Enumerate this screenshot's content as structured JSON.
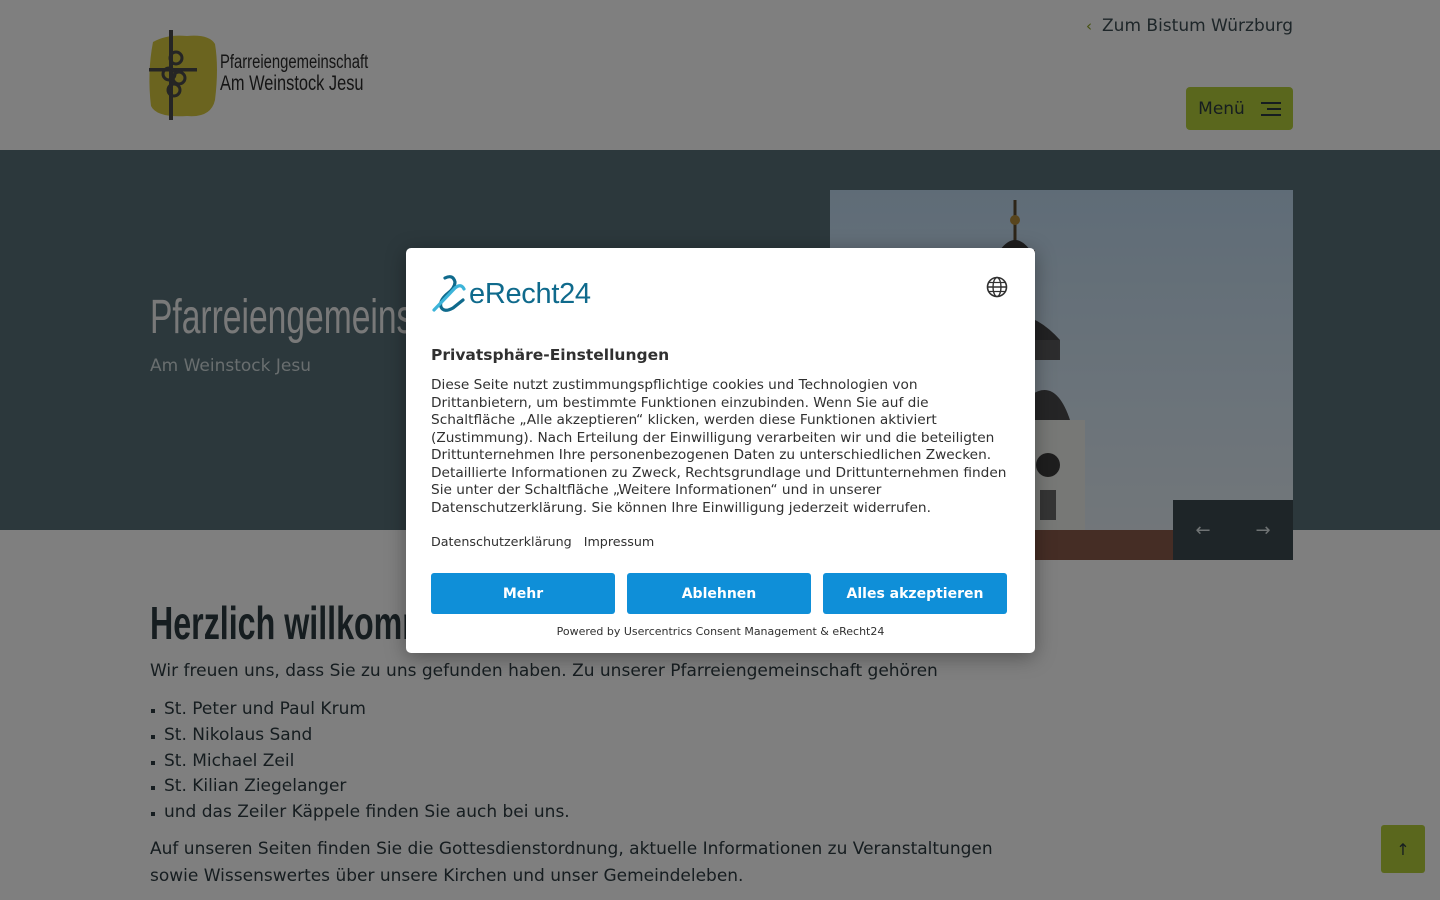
{
  "header": {
    "logo": {
      "line1": "Pfarreiengemeinschaft",
      "line2": "Am Weinstock Jesu"
    },
    "back_link": "Zum Bistum Würzburg",
    "menu_label": "Menü",
    "colors": {
      "accent": "#b4cf3a",
      "logo_yellow": "#d7c93f"
    }
  },
  "hero": {
    "title": "Pfarreiengemeinschaft",
    "subtitle": "Am Weinstock Jesu",
    "background": "#587178",
    "image": "church-tower-photo",
    "prev_icon": "arrow-left-icon",
    "next_icon": "arrow-right-icon"
  },
  "content": {
    "title": "Herzlich willkommen",
    "intro": "Wir freuen uns, dass Sie zu uns gefunden haben. Zu unserer Pfarreiengemeinschaft gehören",
    "churches": [
      "St. Peter und Paul Krum",
      "St. Nikolaus Sand",
      "St. Michael Zeil",
      "St. Kilian Ziegelanger",
      "und das Zeiler Käppele finden Sie auch bei uns."
    ],
    "outro": "Auf unseren Seiten finden Sie die Gottesdienstordnung, aktuelle Informationen zu Veranstaltungen sowie Wissenswertes über unsere Kirchen und unser Gemeindeleben."
  },
  "scroll_top_icon": "arrow-up-icon",
  "consent": {
    "brand": "eRecht24",
    "title": "Privatsphäre-Einstellungen",
    "description": "Diese Seite nutzt zustimmungspflichtige cookies und Technologien von Drittanbietern, um bestimmte Funktionen einzubinden. Wenn Sie auf die Schaltfläche „Alle akzeptieren“ klicken, werden diese Funktionen aktiviert (Zustimmung). Nach Erteilung der Einwilligung verarbeiten wir und die beteiligten Drittunternehmen Ihre personenbezogenen Daten zu unterschiedlichen Zwecken. Detaillierte Informationen zu Zweck, Rechtsgrundlage und Drittunternehmen finden Sie unter der Schaltfläche „Weitere Informationen“ und in unserer Datenschutzerklärung. Sie können Ihre Einwilligung jederzeit widerrufen.",
    "links": {
      "privacy": "Datenschutzerklärung",
      "imprint": "Impressum"
    },
    "buttons": {
      "more": "Mehr",
      "decline": "Ablehnen",
      "accept": "Alles akzeptieren"
    },
    "powered_by": "Powered by Usercentrics Consent Management & eRecht24",
    "button_color": "#0f8fd8",
    "language_icon": "globe-icon"
  }
}
